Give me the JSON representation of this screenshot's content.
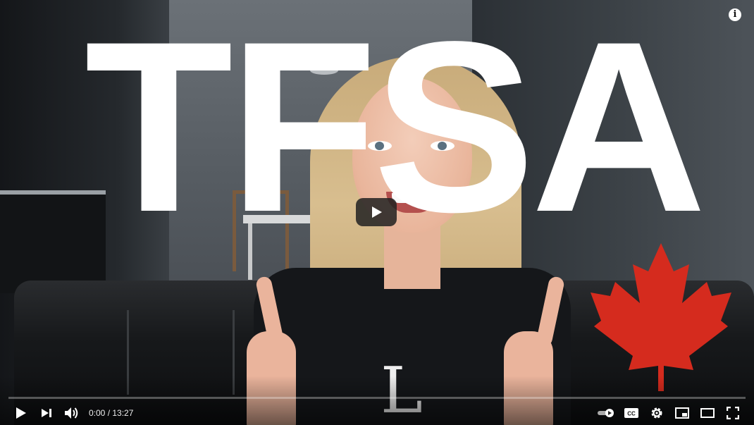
{
  "video": {
    "thumbnail_title_text": "TFSA",
    "current_time": "0:00",
    "separator": " / ",
    "duration": "13:27",
    "progress_fraction": 0.0
  },
  "colors": {
    "progress_red": "#ff0000",
    "maple_red": "#d52b1e",
    "overlay_text": "#ffffff"
  },
  "icons": {
    "info": "info-icon",
    "big_play": "play-icon",
    "play": "play-icon",
    "next": "next-track-icon",
    "volume": "volume-icon",
    "autoplay": "autoplay-toggle-icon",
    "captions": "closed-captions-icon",
    "settings": "gear-icon",
    "miniplayer": "miniplayer-icon",
    "theater": "theater-mode-icon",
    "fullscreen": "fullscreen-icon"
  },
  "labels": {
    "info_glyph": "i",
    "captions_glyph": "CC"
  }
}
